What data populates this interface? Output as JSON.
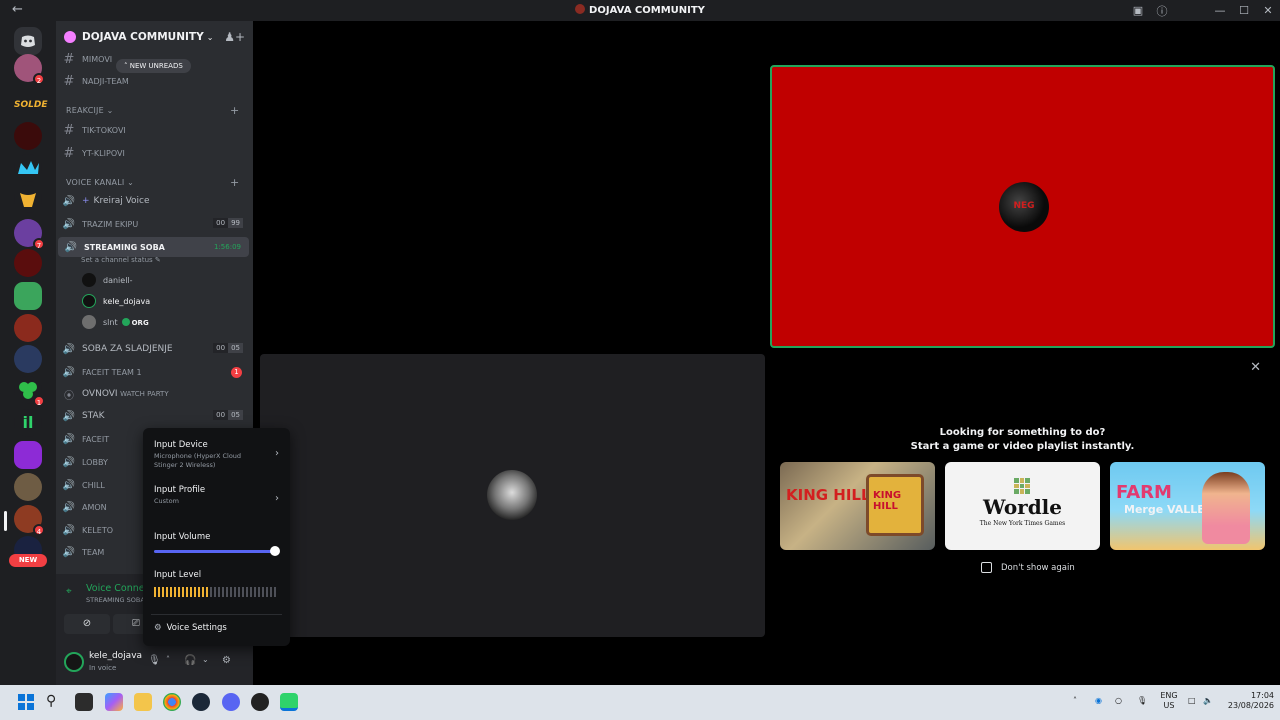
{
  "window": {
    "title": "DOJAVA COMMUNITY"
  },
  "guild": {
    "name": "DOJAVA COMMUNITY"
  },
  "new_unreads": "NEW UNREADS",
  "channels": {
    "top": [
      "MIMOVI",
      "NADJI-TEAM"
    ],
    "reakcije": {
      "label": "REAKCIJE",
      "items": [
        "TIK-TOKOVI",
        "YT-KLIPOVI"
      ]
    },
    "voice": {
      "label": "VOICE KANALI",
      "create": "Kreiraj Voice",
      "trazim": {
        "label": "TRAZIM EKIPU",
        "count_a": "00",
        "count_b": "99"
      },
      "streaming": {
        "label": "STREAMING SOBA",
        "timer": "1:56:09",
        "status_hint": "Set a channel status"
      },
      "users": [
        {
          "name": "daniell-"
        },
        {
          "name": "kele_dojava"
        },
        {
          "name": "slnt",
          "tag": "ORG"
        }
      ],
      "sladjenje": {
        "label": "SOBA ZA SLADJENJE",
        "count_a": "00",
        "count_b": "05"
      },
      "faceit1": {
        "label": "FACEIT TEAM 1",
        "badge": "1"
      },
      "ovnovi": {
        "label": "OVNOVI",
        "suffix": "WATCH PARTY"
      },
      "stak": {
        "label": "STAK",
        "count_a": "00",
        "count_b": "05"
      },
      "truncated": [
        "FACEIT",
        "LOBBY",
        "CHILL",
        "AMON",
        "KELETO",
        "TEAM"
      ]
    }
  },
  "voice_panel": {
    "status": "Voice Connected",
    "location": "STREAMING SOBA / DO"
  },
  "user_panel": {
    "name": "kele_dojava",
    "status": "In voice"
  },
  "input_popup": {
    "device_title": "Input Device",
    "device_value": "Microphone (HyperX Cloud Stinger 2 Wireless)",
    "profile_title": "Input Profile",
    "profile_value": "Custom",
    "volume_title": "Input Volume",
    "volume_level": 1.0,
    "level_title": "Input Level",
    "level_value": 0.45,
    "settings": "Voice Settings"
  },
  "activity": {
    "heading_1": "Looking for something to do?",
    "heading_2": "Start a game or video playlist instantly.",
    "games": [
      {
        "name": "KING HILL"
      },
      {
        "name": "Wordle",
        "subtitle": "The New York Times Games"
      },
      {
        "name": "FARM",
        "subtitle": "Merge VALLEY"
      }
    ],
    "dont_show": "Don't show again"
  },
  "taskbar": {
    "lang": "ENG",
    "region": "US",
    "time": "17:04",
    "date": "23/08/2026"
  },
  "server_badges": [
    "2",
    "7",
    "1",
    "4"
  ],
  "new_button": "NEW",
  "stream_tile_text": "NEG"
}
